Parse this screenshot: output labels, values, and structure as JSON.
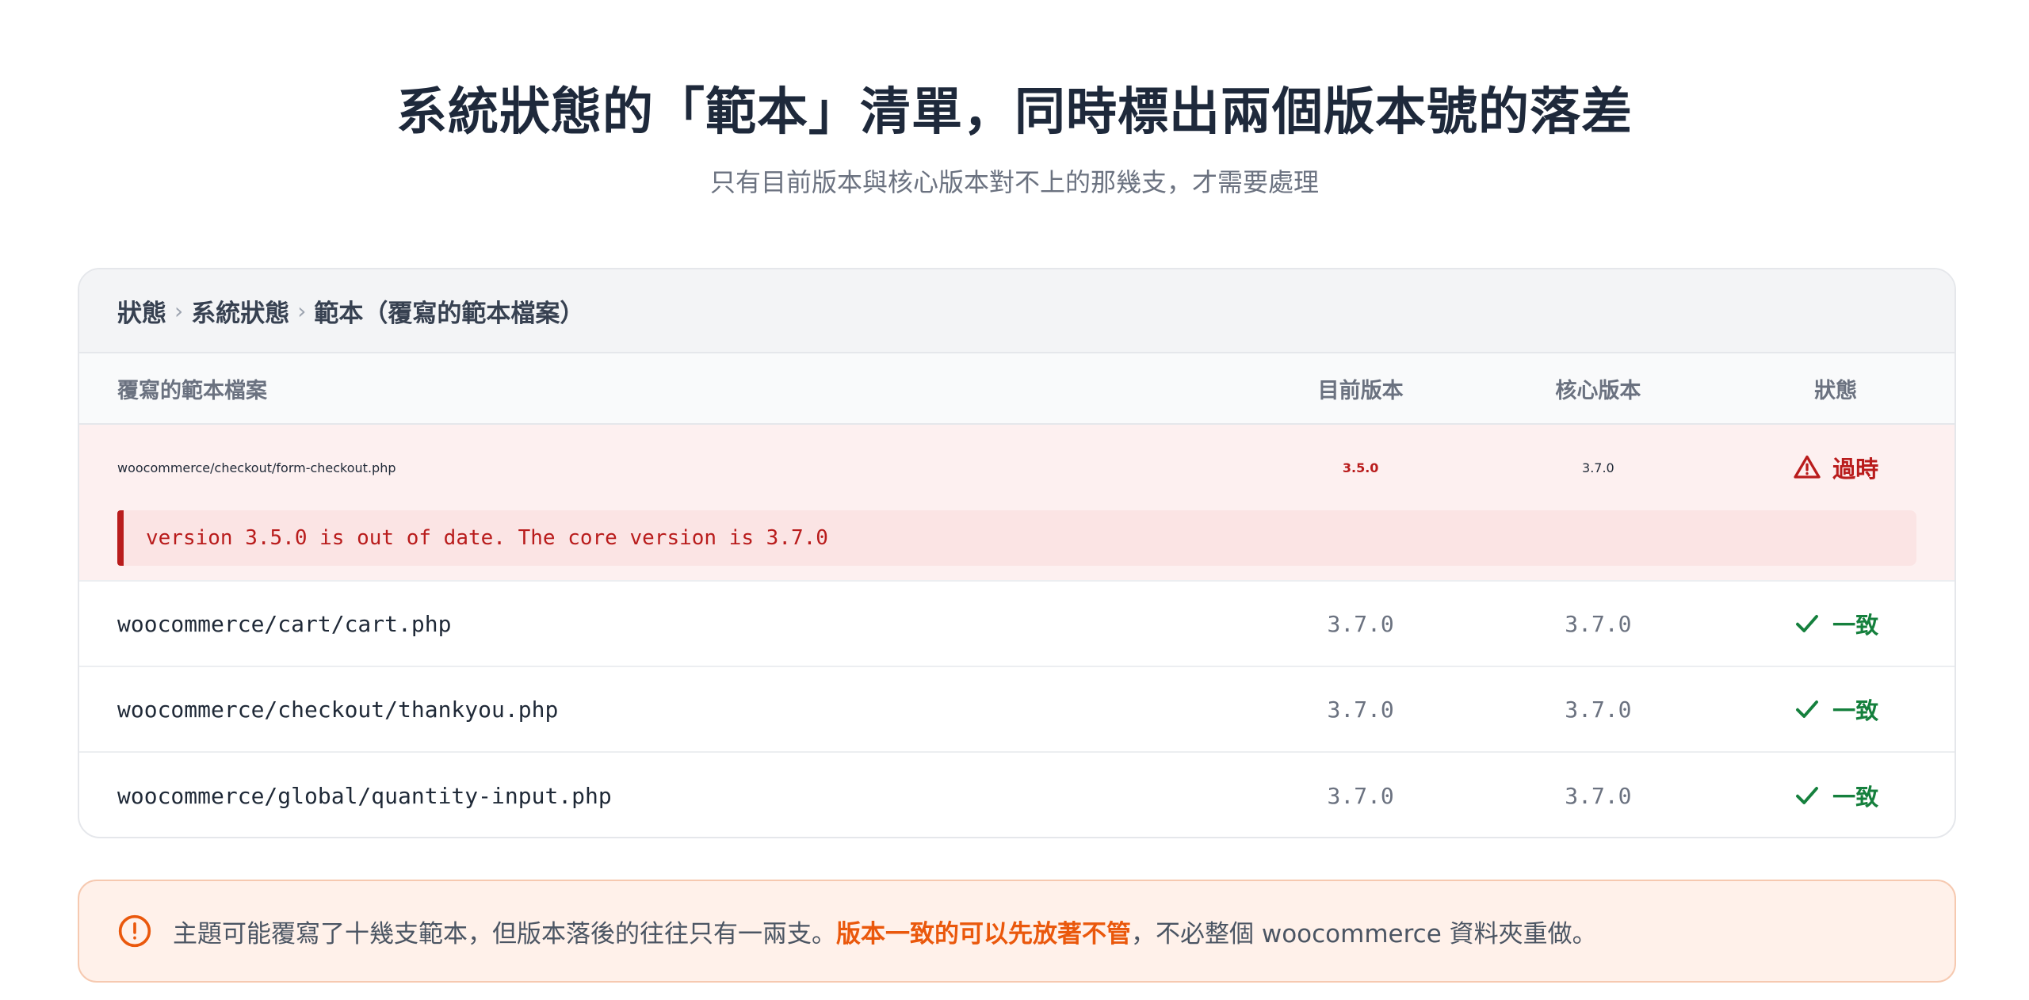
{
  "header": {
    "title": "系統狀態的「範本」清單，同時標出兩個版本號的落差",
    "subtitle": "只有目前版本與核心版本對不上的那幾支，才需要處理"
  },
  "breadcrumb": {
    "items": [
      "狀態",
      "系統狀態",
      "範本（覆寫的範本檔案）"
    ],
    "separator": "›"
  },
  "table": {
    "columns": {
      "file": "覆寫的範本檔案",
      "current": "目前版本",
      "core": "核心版本",
      "status": "狀態"
    },
    "rows": [
      {
        "file": "woocommerce/checkout/form-checkout.php",
        "current": "3.5.0",
        "core": "3.7.0",
        "status": "過時",
        "status_icon": "warning-triangle-icon",
        "message": "version 3.5.0 is out of date. The core version is 3.7.0"
      },
      {
        "file": "woocommerce/cart/cart.php",
        "current": "3.7.0",
        "core": "3.7.0",
        "status": "一致",
        "status_icon": "check-icon"
      },
      {
        "file": "woocommerce/checkout/thankyou.php",
        "current": "3.7.0",
        "core": "3.7.0",
        "status": "一致",
        "status_icon": "check-icon"
      },
      {
        "file": "woocommerce/global/quantity-input.php",
        "current": "3.7.0",
        "core": "3.7.0",
        "status": "一致",
        "status_icon": "check-icon"
      }
    ]
  },
  "note": {
    "icon": "exclamation-circle-icon",
    "text_before": "主題可能覆寫了十幾支範本，但版本落後的往往只有一兩支。",
    "text_emphasis": "版本一致的可以先放著不管",
    "text_after": "，不必整個 woocommerce 資料夾重做。"
  },
  "colors": {
    "outdated": "#b91c1c",
    "ok": "#15803d",
    "accent": "#ea580c"
  }
}
